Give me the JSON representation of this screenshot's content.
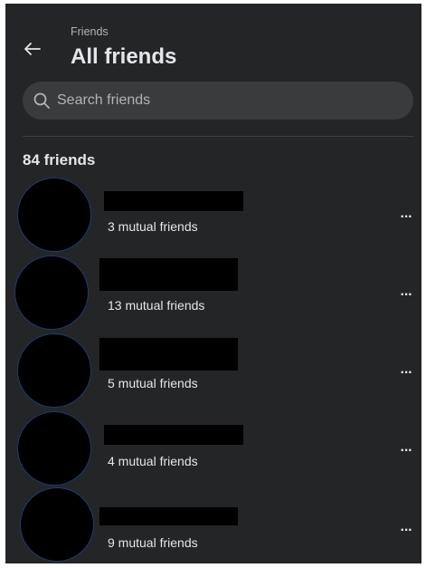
{
  "header": {
    "breadcrumb": "Friends",
    "title": "All friends",
    "back_icon": "arrow-left-icon"
  },
  "search": {
    "placeholder": "Search friends",
    "value": "",
    "icon": "search-icon"
  },
  "friends_count": "84 friends",
  "friends": [
    {
      "mutual": "3 mutual friends",
      "name_redacted": true
    },
    {
      "mutual": "13 mutual friends",
      "name_redacted": true
    },
    {
      "mutual": "5 mutual friends",
      "name_redacted": true
    },
    {
      "mutual": "4 mutual friends",
      "name_redacted": true
    },
    {
      "mutual": "9 mutual friends",
      "name_redacted": true
    }
  ],
  "more_label": "···",
  "colors": {
    "panel_bg": "#242526",
    "search_bg": "#3a3b3c",
    "text_primary": "#e4e6eb",
    "text_secondary": "#b0b3b8",
    "avatar_ring": "#1e3a78",
    "redaction": "#000000"
  }
}
